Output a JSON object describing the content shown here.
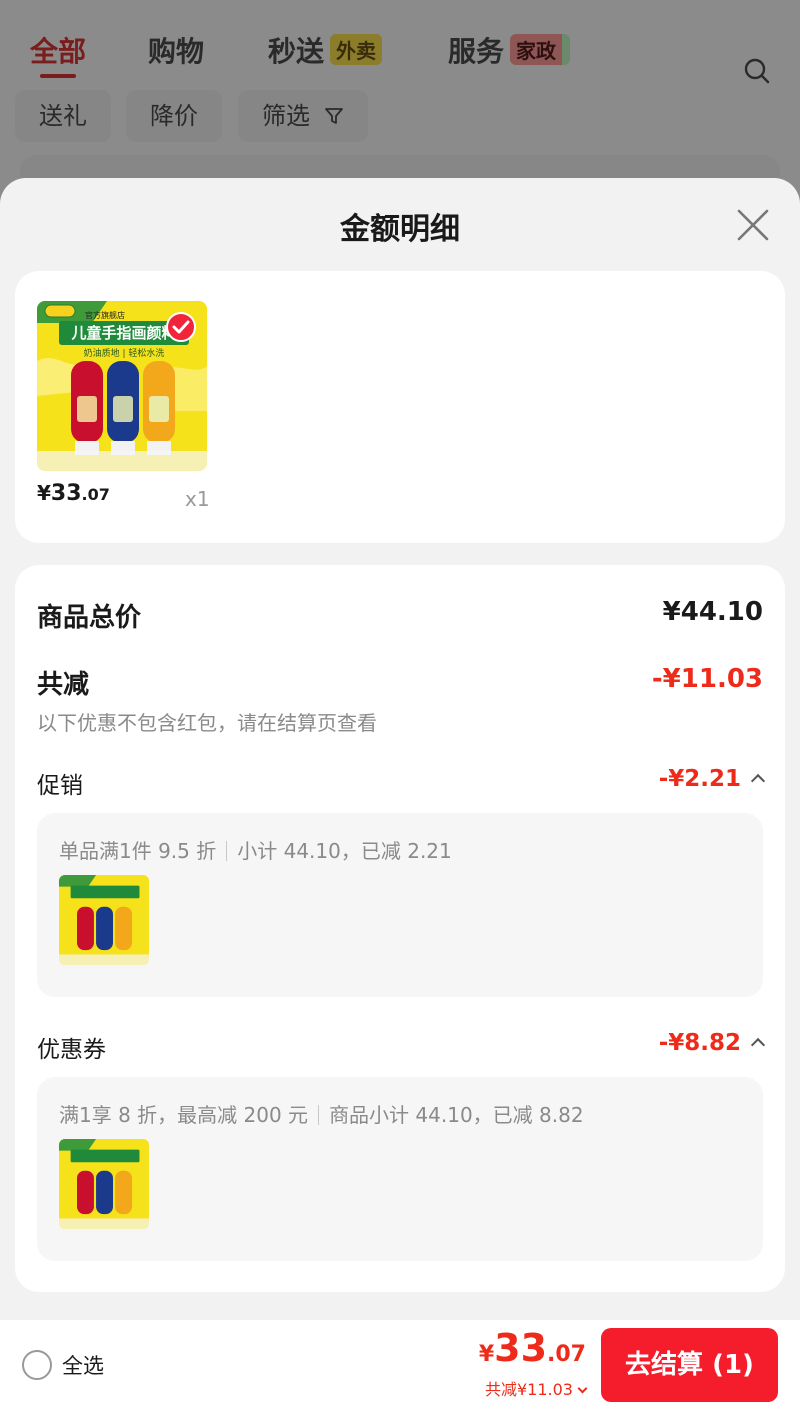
{
  "background": {
    "tabs": [
      {
        "label": "全部"
      },
      {
        "label": "购物"
      },
      {
        "label": "秒送",
        "badge": "外卖"
      },
      {
        "label": "服务",
        "badge": "家政"
      }
    ],
    "chips": [
      "送礼",
      "降价",
      "筛选"
    ]
  },
  "sheet": {
    "title": "金额明细"
  },
  "product": {
    "price_yen": "¥",
    "price_int": "33",
    "price_dec": ".07",
    "qty": "x1",
    "image": {
      "store_text": "官方旗舰店",
      "title_text": "儿童手指画颜料",
      "sub_text": "奶油质地 | 轻松水洗"
    }
  },
  "summary": {
    "total_label": "商品总价",
    "total_value": "¥44.10",
    "reduced_label": "共减",
    "reduced_value": "-¥11.03",
    "note": "以下优惠不包含红包，请在结算页查看"
  },
  "promotion": {
    "label": "促销",
    "value": "-¥2.21",
    "detail_a": "单品满1件 9.5 折",
    "detail_b": "小计 44.10，已减 2.21"
  },
  "coupon": {
    "label": "优惠券",
    "value": "-¥8.82",
    "detail_a": "满1享 8 折，最高减 200 元",
    "detail_b": "商品小计 44.10，已减 8.82"
  },
  "footer": {
    "select_all": "全选",
    "total_yen": "¥",
    "total_int": "33",
    "total_dec": ".07",
    "reduced": "共减¥11.03",
    "checkout": "去结算 (1)"
  },
  "colors": {
    "accent_red": "#ee2b1a",
    "checkout_red": "#f51d2c",
    "product_yellow": "#f5e21a"
  }
}
